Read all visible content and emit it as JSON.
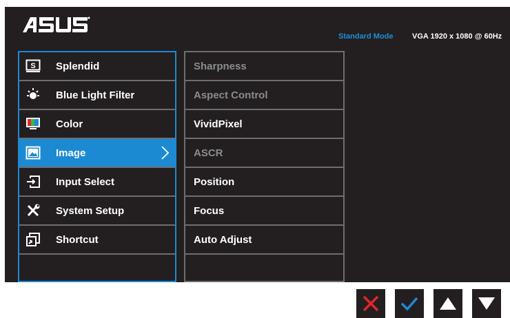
{
  "header": {
    "logo": "ASUS",
    "mode": "Standard Mode",
    "signal": "VGA  1920 x 1080 @ 60Hz"
  },
  "menu": {
    "items": [
      {
        "label": "Splendid",
        "icon": "splendid-icon"
      },
      {
        "label": "Blue Light Filter",
        "icon": "blue-light-icon"
      },
      {
        "label": "Color",
        "icon": "color-icon"
      },
      {
        "label": "Image",
        "icon": "image-icon",
        "selected": true
      },
      {
        "label": "Input Select",
        "icon": "input-select-icon"
      },
      {
        "label": "System Setup",
        "icon": "system-setup-icon"
      },
      {
        "label": "Shortcut",
        "icon": "shortcut-icon"
      }
    ]
  },
  "submenu": {
    "items": [
      {
        "label": "Sharpness",
        "enabled": false
      },
      {
        "label": "Aspect Control",
        "enabled": false
      },
      {
        "label": "VividPixel",
        "enabled": true
      },
      {
        "label": "ASCR",
        "enabled": false
      },
      {
        "label": "Position",
        "enabled": true
      },
      {
        "label": "Focus",
        "enabled": true
      },
      {
        "label": "Auto Adjust",
        "enabled": true
      }
    ]
  },
  "controls": {
    "buttons": [
      {
        "icon": "close-icon",
        "color": "#e2262b"
      },
      {
        "icon": "check-icon",
        "color": "#1c8ad3"
      },
      {
        "icon": "up-arrow-icon",
        "color": "#ffffff"
      },
      {
        "icon": "down-arrow-icon",
        "color": "#ffffff"
      }
    ]
  },
  "colors": {
    "accent": "#1c8ad3",
    "background": "#231f20",
    "divider": "#6d6e71",
    "disabled_text": "#8a8b8e"
  }
}
